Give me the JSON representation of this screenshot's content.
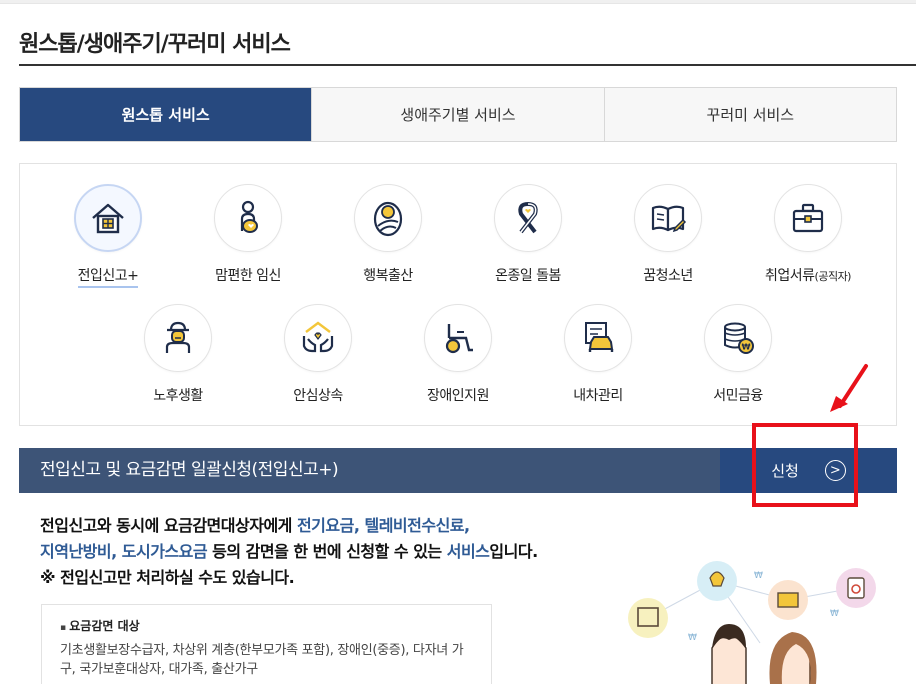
{
  "page": {
    "title": "원스톱/생애주기/꾸러미 서비스"
  },
  "tabs": [
    {
      "label": "원스톱 서비스",
      "active": true
    },
    {
      "label": "생애주기별 서비스",
      "active": false
    },
    {
      "label": "꾸러미 서비스",
      "active": false
    }
  ],
  "services": {
    "row1": [
      {
        "label": "전입신고+",
        "icon": "house-icon",
        "active": true
      },
      {
        "label": "맘편한 임신",
        "icon": "pregnant-mother-icon"
      },
      {
        "label": "행복출산",
        "icon": "newborn-baby-icon"
      },
      {
        "label": "온종일 돌봄",
        "icon": "care-ribbon-icon"
      },
      {
        "label": "꿈청소년",
        "icon": "open-book-icon"
      },
      {
        "label": "취업서류",
        "label_small": "(공직자)",
        "icon": "briefcase-icon"
      }
    ],
    "row2": [
      {
        "label": "노후생활",
        "icon": "elderly-person-icon"
      },
      {
        "label": "안심상속",
        "icon": "hands-heart-home-icon"
      },
      {
        "label": "장애인지원",
        "icon": "wheelchair-icon"
      },
      {
        "label": "내차관리",
        "icon": "car-document-icon"
      },
      {
        "label": "서민금융",
        "icon": "coin-stack-icon"
      }
    ]
  },
  "selected_service": {
    "title": "전입신고 및 요금감면 일괄신청(전입신고+)",
    "apply_label": "신청",
    "apply_icon": "circle-arrow-right-icon"
  },
  "description": {
    "part1": "전입신고와 동시에 요금감면대상자에게 ",
    "highlight1": "전기요금, 텔레비전수신료,",
    "highlight2": "지역난방비, 도시가스요금",
    "part2": " 등의 감면을 한 번에 신청할 수 있는 ",
    "highlight3": "서비스",
    "part3": "입니다.",
    "note": "※ 전입신고만 처리하실 수도 있습니다."
  },
  "reduction_target": {
    "heading": "요금감면 대상",
    "text": "기초생활보장수급자, 차상위 계층(한부모가족 포함), 장애인(중증), 다자녀 가구, 국가보훈대상자, 대가족, 출산가구"
  },
  "colors": {
    "primary_navy": "#27497f",
    "bar_slate": "#3d5477",
    "highlight_blue": "#2f5b95",
    "annotation_red": "#e8111a",
    "icon_gold": "#f3c63a"
  }
}
